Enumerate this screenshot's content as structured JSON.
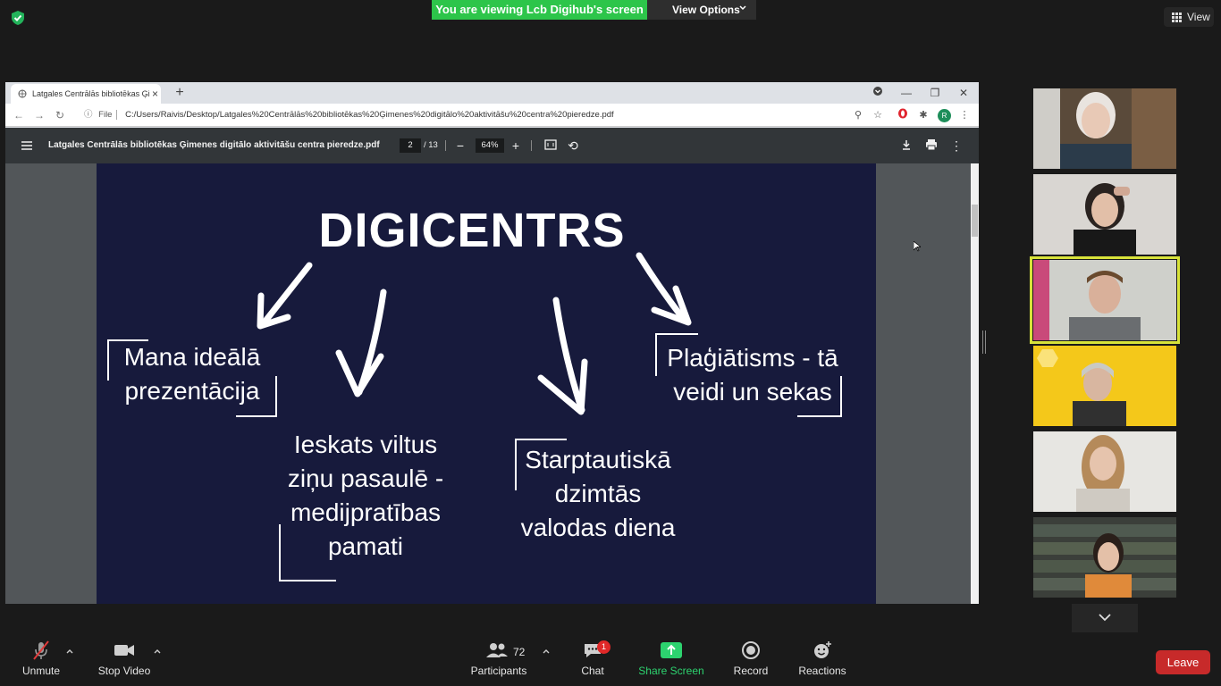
{
  "top": {
    "viewing_banner": "You are viewing Lcb Digihub's screen",
    "view_options": "View Options",
    "view_button": "View"
  },
  "browser": {
    "tab_title": "Latgales Centrālās bibliotēkas Ģi",
    "url_prefix": "File",
    "url": "C:/Users/Raivis/Desktop/Latgales%20Centrālās%20bibliotēkas%20Ģimenes%20digitālo%20aktivitāšu%20centra%20pieredze.pdf",
    "profile_initial": "R"
  },
  "pdf": {
    "title": "Latgales Centrālās bibliotēkas Ģimenes digitālo aktivitāšu centra pieredze.pdf",
    "page": "2",
    "total": "/ 13",
    "zoom": "64%"
  },
  "slide": {
    "title": "DIGICENTRS",
    "item1": [
      "Mana ideālā",
      "prezentācija"
    ],
    "item2": [
      "Ieskats viltus",
      "ziņu pasaulē -",
      "medijpratības",
      "pamati"
    ],
    "item3": [
      "Starptautiskā",
      "dzimtās",
      "valodas diena"
    ],
    "item4": [
      "Plaģiātisms - tā",
      "veidi un sekas"
    ]
  },
  "toolbar": {
    "unmute": "Unmute",
    "stop_video": "Stop Video",
    "participants": "Participants",
    "participant_count": "72",
    "chat": "Chat",
    "chat_badge": "1",
    "share_screen": "Share Screen",
    "record": "Record",
    "reactions": "Reactions",
    "leave": "Leave"
  },
  "colors": {
    "banner_green": "#2dc54a",
    "slide_bg": "#171a3c",
    "leave_red": "#c72a2a",
    "active_speaker": "#d8e33a"
  }
}
